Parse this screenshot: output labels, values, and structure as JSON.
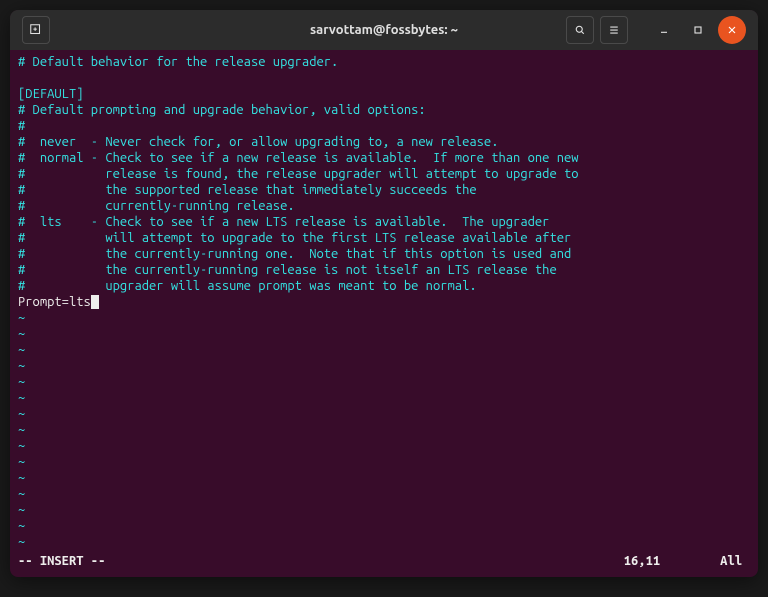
{
  "titlebar": {
    "title": "sarvottam@fossbytes: ~"
  },
  "content": {
    "lines": [
      "# Default behavior for the release upgrader.",
      "",
      "[DEFAULT]",
      "# Default prompting and upgrade behavior, valid options:",
      "#",
      "#  never  - Never check for, or allow upgrading to, a new release.",
      "#  normal - Check to see if a new release is available.  If more than one new",
      "#           release is found, the release upgrader will attempt to upgrade to",
      "#           the supported release that immediately succeeds the",
      "#           currently-running release.",
      "#  lts    - Check to see if a new LTS release is available.  The upgrader",
      "#           will attempt to upgrade to the first LTS release available after",
      "#           the currently-running one.  Note that if this option is used and",
      "#           the currently-running release is not itself an LTS release the",
      "#           upgrader will assume prompt was meant to be normal."
    ],
    "prompt_line": "Prompt=lts",
    "tilde": "~"
  },
  "status": {
    "mode": "-- INSERT --",
    "position": "16,11",
    "scroll": "All"
  }
}
